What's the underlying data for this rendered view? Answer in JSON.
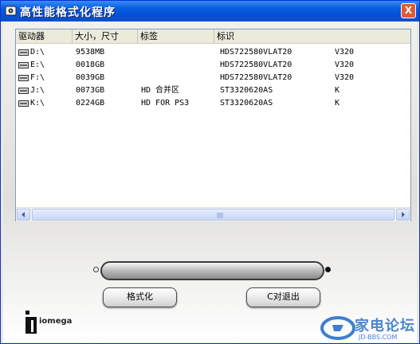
{
  "window": {
    "title": "高性能格式化程序",
    "close_glyph": "X"
  },
  "list": {
    "columns": [
      "驱动器",
      "大小，尺寸",
      "标签",
      "标识"
    ],
    "rows": [
      {
        "drive": "D:\\",
        "size": "9538MB",
        "label": "",
        "model": "HDS722580VLAT20",
        "rev": "V320"
      },
      {
        "drive": "E:\\",
        "size": "0018GB",
        "label": "",
        "model": "HDS722580VLAT20",
        "rev": "V320"
      },
      {
        "drive": "F:\\",
        "size": "0039GB",
        "label": "",
        "model": "HDS722580VLAT20",
        "rev": "V320"
      },
      {
        "drive": "J:\\",
        "size": "0073GB",
        "label": "HD 合并区",
        "model": "ST3320620AS",
        "rev": "K"
      },
      {
        "drive": "K:\\",
        "size": "0224GB",
        "label": "HD FOR PS3",
        "model": "ST3320620AS",
        "rev": "K"
      }
    ]
  },
  "buttons": {
    "format": "格式化",
    "exit": "C对退出"
  },
  "logo": {
    "brand": "iomega"
  },
  "watermark": {
    "text": "家电论坛",
    "sub": "JD-BBS.COM"
  }
}
